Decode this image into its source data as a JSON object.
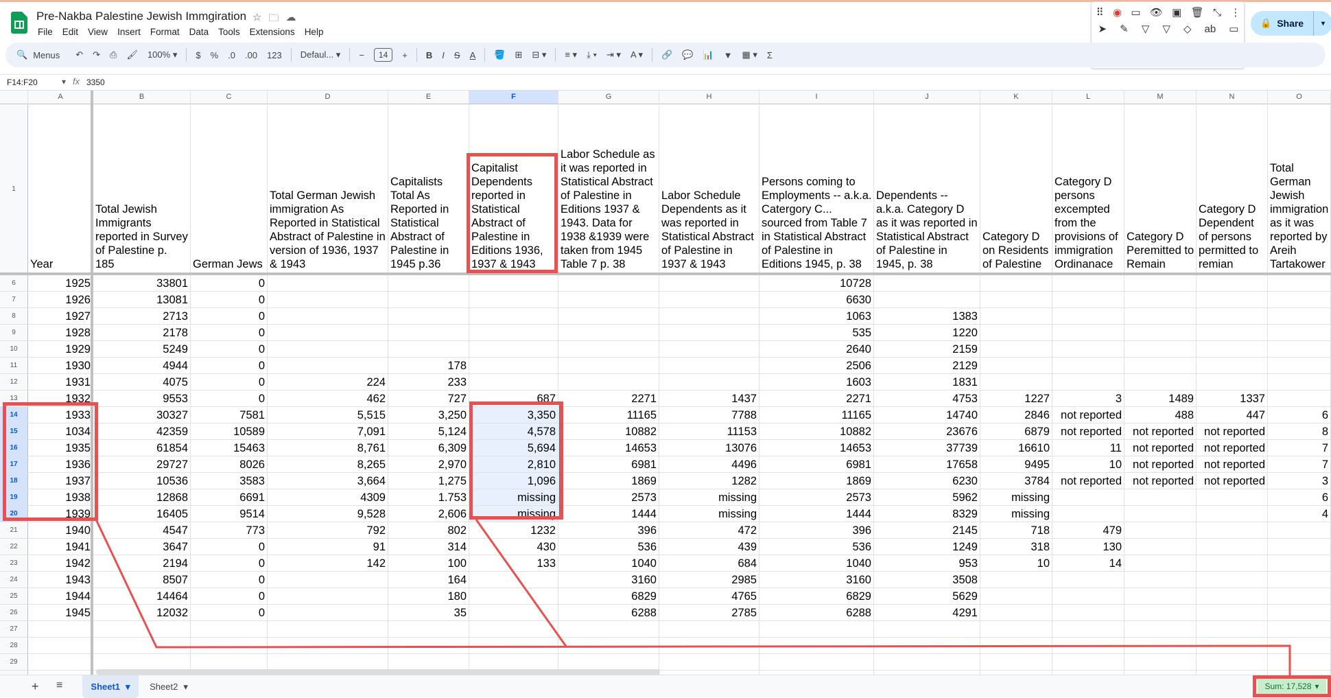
{
  "doc": {
    "title": "Pre-Nakba Palestine Jewish Immgiration"
  },
  "menu": [
    "File",
    "Edit",
    "View",
    "Insert",
    "Format",
    "Data",
    "Tools",
    "Extensions",
    "Help"
  ],
  "share": {
    "label": "Share"
  },
  "toolbar": {
    "search": "Menus",
    "zoom": "100%",
    "currency": "$",
    "percent": "%",
    "dec_less": ".0",
    "dec_more": ".00",
    "num_format": "123",
    "font": "Defaul...",
    "font_size": "14"
  },
  "draw_colors": [
    "#000000",
    "#fbbc04",
    "#ea4335",
    "#c5221f",
    "#0f9d58",
    "#1a73e8",
    "#ffffff"
  ],
  "formula": {
    "cell_ref": "F14:F20",
    "fx": "fx",
    "value": "3350"
  },
  "columns": [
    "A",
    "B",
    "C",
    "D",
    "E",
    "F",
    "G",
    "H",
    "I",
    "J",
    "K",
    "L",
    "M",
    "N",
    "O"
  ],
  "headers": [
    "Year",
    "Total Jewish Immigrants reported in Survey of Palestine p. 185",
    "German Jews",
    "Total German Jewish immigration As Reported in Statistical Abstract of Palestine in version  of 1936, 1937 & 1943",
    "Capitalists Total As Reported in Statistical Abstract of Palestine in 1945 p.36",
    "Capitalist Dependents reported  in Statistical Abstract of Palestine in Editions 1936, 1937 & 1943",
    "Labor Schedule as it was reported in Statistical Abstract of Palestine in Editions 1937 & 1943. Data for 1938 &1939 were taken from 1945 Table 7 p. 38",
    "Labor Schedule Dependents as it was reported in Statistical Abstract of Palestine in 1937 & 1943",
    "Persons coming to Employments -- a.k.a. Catergory C... sourced from Table 7 in Statistical Abstract of Palestine in Editions 1945, p. 38",
    "Dependents -- a.k.a. Category D as it was reported in Statistical Abstract of Palestine in 1945, p. 38",
    "Category D on Residents of Palestine",
    "Category D persons excempted from the provisions of immigration Ordinanace",
    "Category D Peremitted to Remain",
    "Category D Dependent of persons permitted to remian",
    "Total German Jewish immigration as it was reported by Areih Tartakower"
  ],
  "rows": [
    {
      "n": "6",
      "c": [
        "1925",
        "33801",
        "0",
        "",
        "",
        "",
        "",
        "",
        "10728",
        "",
        "",
        "",
        "",
        "",
        ""
      ]
    },
    {
      "n": "7",
      "c": [
        "1926",
        "13081",
        "0",
        "",
        "",
        "",
        "",
        "",
        "6630",
        "",
        "",
        "",
        "",
        "",
        ""
      ]
    },
    {
      "n": "8",
      "c": [
        "1927",
        "2713",
        "0",
        "",
        "",
        "",
        "",
        "",
        "1063",
        "1383",
        "",
        "",
        "",
        "",
        ""
      ]
    },
    {
      "n": "9",
      "c": [
        "1928",
        "2178",
        "0",
        "",
        "",
        "",
        "",
        "",
        "535",
        "1220",
        "",
        "",
        "",
        "",
        ""
      ]
    },
    {
      "n": "10",
      "c": [
        "1929",
        "5249",
        "0",
        "",
        "",
        "",
        "",
        "",
        "2640",
        "2159",
        "",
        "",
        "",
        "",
        ""
      ]
    },
    {
      "n": "11",
      "c": [
        "1930",
        "4944",
        "0",
        "",
        "178",
        "",
        "",
        "",
        "2506",
        "2129",
        "",
        "",
        "",
        "",
        ""
      ]
    },
    {
      "n": "12",
      "c": [
        "1931",
        "4075",
        "0",
        "224",
        "233",
        "",
        "",
        "",
        "1603",
        "1831",
        "",
        "",
        "",
        "",
        ""
      ]
    },
    {
      "n": "13",
      "c": [
        "1932",
        "9553",
        "0",
        "462",
        "727",
        "687",
        "2271",
        "1437",
        "2271",
        "4753",
        "1227",
        "3",
        "1489",
        "1337",
        ""
      ]
    },
    {
      "n": "14",
      "c": [
        "1933",
        "30327",
        "7581",
        "5,515",
        "3,250",
        "3,350",
        "11165",
        "7788",
        "11165",
        "14740",
        "2846",
        "not reported",
        "488",
        "447",
        "6"
      ]
    },
    {
      "n": "15",
      "c": [
        "1034",
        "42359",
        "10589",
        "7,091",
        "5,124",
        "4,578",
        "10882",
        "11153",
        "10882",
        "23676",
        "6879",
        "not reported",
        "not reported",
        "not reported",
        "8"
      ]
    },
    {
      "n": "16",
      "c": [
        "1935",
        "61854",
        "15463",
        "8,761",
        "6,309",
        "5,694",
        "14653",
        "13076",
        "14653",
        "37739",
        "16610",
        "11",
        "not reported",
        "not reported",
        "7"
      ]
    },
    {
      "n": "17",
      "c": [
        "1936",
        "29727",
        "8026",
        "8,265",
        "2,970",
        "2,810",
        "6981",
        "4496",
        "6981",
        "17658",
        "9495",
        "10",
        "not reported",
        "not reported",
        "7"
      ]
    },
    {
      "n": "18",
      "c": [
        "1937",
        "10536",
        "3583",
        "3,664",
        "1,275",
        "1,096",
        "1869",
        "1282",
        "1869",
        "6230",
        "3784",
        "not reported",
        "not reported",
        "not reported",
        "3"
      ]
    },
    {
      "n": "19",
      "c": [
        "1938",
        "12868",
        "6691",
        "4309",
        "1.753",
        "missing",
        "2573",
        "missing",
        "2573",
        "5962",
        "missing",
        "",
        "",
        "",
        "6"
      ]
    },
    {
      "n": "20",
      "c": [
        "1939",
        "16405",
        "9514",
        "9,528",
        "2,606",
        "missing",
        "1444",
        "missing",
        "1444",
        "8329",
        "missing",
        "",
        "",
        "",
        "4"
      ]
    },
    {
      "n": "21",
      "c": [
        "1940",
        "4547",
        "773",
        "792",
        "802",
        "1232",
        "396",
        "472",
        "396",
        "2145",
        "718",
        "479",
        "",
        "",
        ""
      ]
    },
    {
      "n": "22",
      "c": [
        "1941",
        "3647",
        "0",
        "91",
        "314",
        "430",
        "536",
        "439",
        "536",
        "1249",
        "318",
        "130",
        "",
        "",
        ""
      ]
    },
    {
      "n": "23",
      "c": [
        "1942",
        "2194",
        "0",
        "142",
        "100",
        "133",
        "1040",
        "684",
        "1040",
        "953",
        "10",
        "14",
        "",
        "",
        ""
      ]
    },
    {
      "n": "24",
      "c": [
        "1943",
        "8507",
        "0",
        "",
        "164",
        "",
        "3160",
        "2985",
        "3160",
        "3508",
        "",
        "",
        "",
        "",
        ""
      ]
    },
    {
      "n": "25",
      "c": [
        "1944",
        "14464",
        "0",
        "",
        "180",
        "",
        "6829",
        "4765",
        "6829",
        "5629",
        "",
        "",
        "",
        "",
        ""
      ]
    },
    {
      "n": "26",
      "c": [
        "1945",
        "12032",
        "0",
        "",
        "35",
        "",
        "6288",
        "2785",
        "6288",
        "4291",
        "",
        "",
        "",
        "",
        ""
      ]
    },
    {
      "n": "27",
      "c": [
        "",
        "",
        "",
        "",
        "",
        "",
        "",
        "",
        "",
        "",
        "",
        "",
        "",
        "",
        ""
      ]
    },
    {
      "n": "28",
      "c": [
        "",
        "",
        "",
        "",
        "",
        "",
        "",
        "",
        "",
        "",
        "",
        "",
        "",
        "",
        ""
      ]
    },
    {
      "n": "29",
      "c": [
        "",
        "",
        "",
        "",
        "",
        "",
        "",
        "",
        "",
        "",
        "",
        "",
        "",
        "",
        ""
      ]
    },
    {
      "n": "30",
      "c": [
        "",
        "",
        "",
        "",
        "",
        "",
        "",
        "",
        "",
        "",
        "",
        "",
        "",
        "",
        ""
      ]
    }
  ],
  "sheets": [
    "Sheet1",
    "Sheet2"
  ],
  "sum": "Sum: 17,528"
}
